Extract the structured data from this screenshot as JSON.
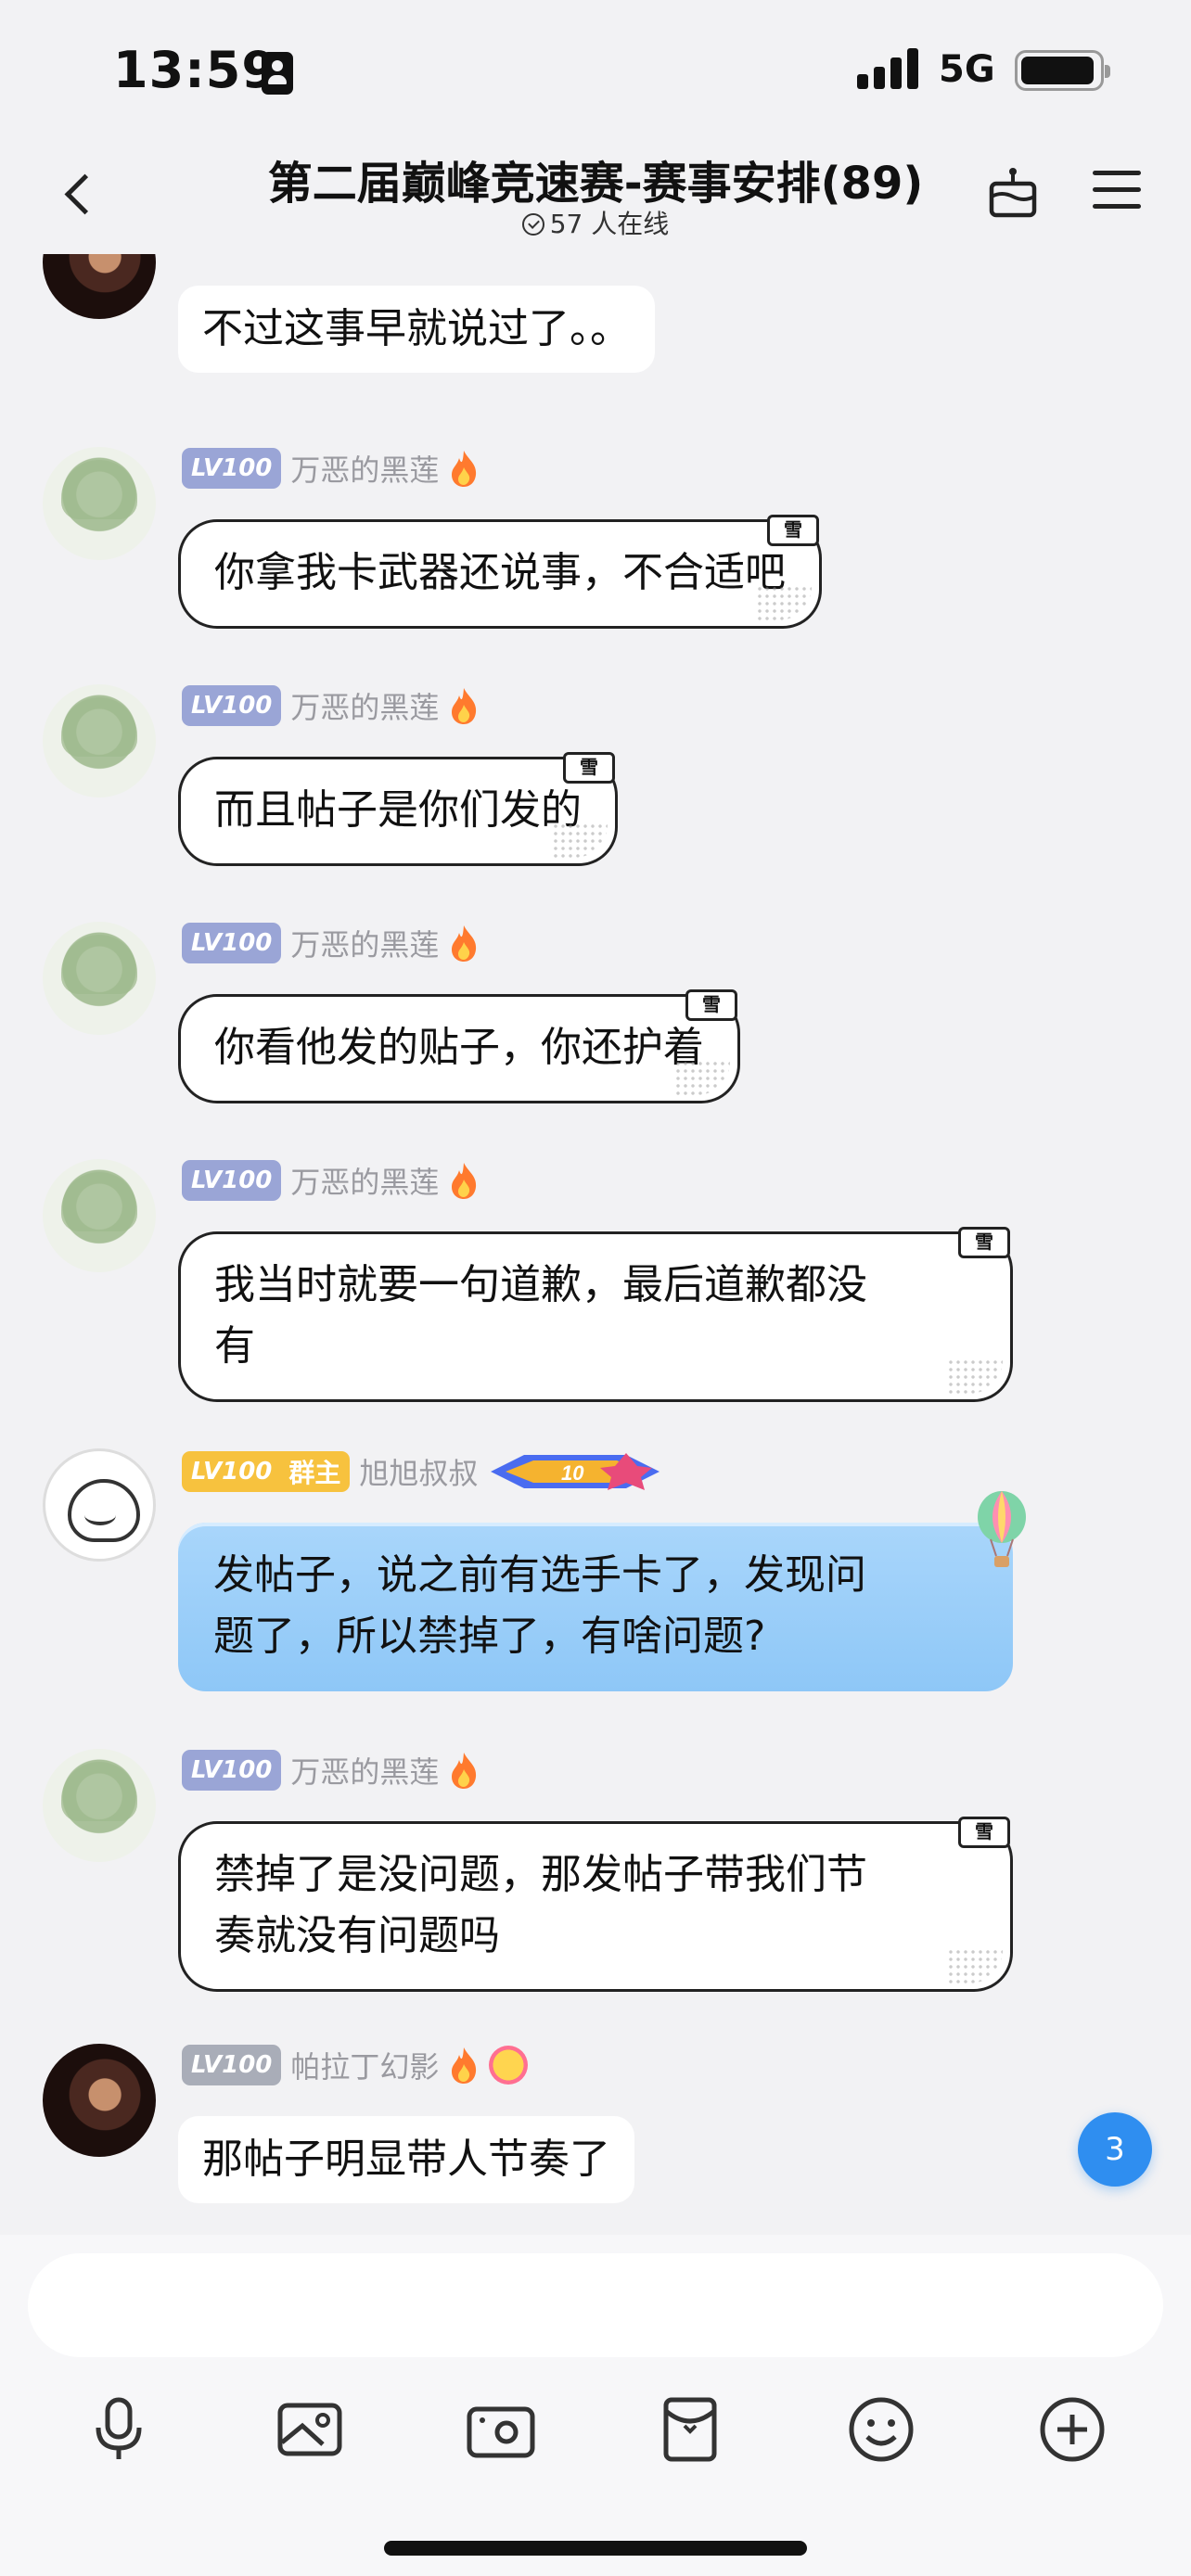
{
  "status_bar": {
    "time": "13:59",
    "network": "5G"
  },
  "nav": {
    "title": "第二届巅峰竞速赛-赛事安排(89)",
    "online": "57 人在线"
  },
  "messages": [
    {
      "sender": "",
      "level": "",
      "text": "不过这事早就说过了。。",
      "style": "plain"
    },
    {
      "sender": "万恶的黑莲",
      "level": "LV100",
      "text": "你拿我卡武器还说事，不合适吧",
      "style": "framed"
    },
    {
      "sender": "万恶的黑莲",
      "level": "LV100",
      "text": "而且帖子是你们发的",
      "style": "framed"
    },
    {
      "sender": "万恶的黑莲",
      "level": "LV100",
      "text": "你看他发的贴子，你还护着",
      "style": "framed"
    },
    {
      "sender": "万恶的黑莲",
      "level": "LV100",
      "text_lines": [
        "我当时就要一句道歉，最后道歉都没",
        "有"
      ],
      "style": "framed"
    },
    {
      "sender": "旭旭叔叔",
      "level": "LV100",
      "role": "群主",
      "rank": "10",
      "text_lines": [
        "发帖子，说之前有选手卡了，发现问",
        "题了，所以禁掉了，有啥问题?"
      ],
      "style": "blue"
    },
    {
      "sender": "万恶的黑莲",
      "level": "LV100",
      "text_lines": [
        "禁掉了是没问题，那发帖子带我们节",
        "奏就没有问题吗"
      ],
      "style": "framed"
    },
    {
      "sender": "帕拉丁幻影",
      "level": "LV100",
      "text": "那帖子明显带人节奏了",
      "style": "plain"
    }
  ],
  "stamp_label": "雪",
  "unread_count": "3",
  "input": {
    "value": ""
  },
  "toolbar": [
    "microphone-icon",
    "image-icon",
    "camera-icon",
    "red-packet-icon",
    "emoji-icon",
    "plus-icon"
  ],
  "colors": {
    "accent_blue": "#2f8ef0",
    "lv_badge": "#9aa5d6",
    "owner_badge": "#f7c23e",
    "bubble_blue": "#a9d6fb"
  }
}
